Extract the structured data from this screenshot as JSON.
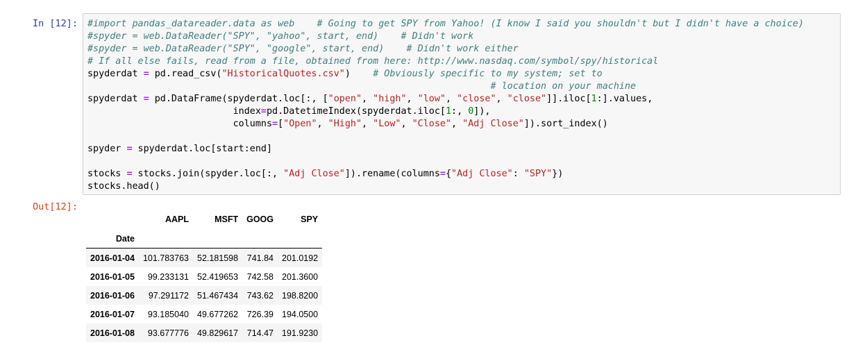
{
  "cell": {
    "in_prompt": "In [12]:",
    "out_prompt": "Out[12]:",
    "code_lines": [
      [
        {
          "t": "c",
          "v": "#import pandas_datareader.data as web    # Going to get SPY from Yahoo! (I know I said you shouldn't but I didn't have a choice)"
        }
      ],
      [
        {
          "t": "c",
          "v": "#spyder = web.DataReader(\"SPY\", \"yahoo\", start, end)    # Didn't work"
        }
      ],
      [
        {
          "t": "c",
          "v": "#spyder = web.DataReader(\"SPY\", \"google\", start, end)    # Didn't work either"
        }
      ],
      [
        {
          "t": "c",
          "v": "# If all else fails, read from a file, obtained from here: http://www.nasdaq.com/symbol/spy/historical"
        }
      ],
      [
        {
          "t": "t",
          "v": "spyderdat "
        },
        {
          "t": "o",
          "v": "="
        },
        {
          "t": "t",
          "v": " pd.read_csv("
        },
        {
          "t": "s",
          "v": "\"HistoricalQuotes.csv\""
        },
        {
          "t": "t",
          "v": ")    "
        },
        {
          "t": "c",
          "v": "# Obviously specific to my system; set to"
        }
      ],
      [
        {
          "t": "t",
          "v": "                                                                        "
        },
        {
          "t": "c",
          "v": "# location on your machine"
        }
      ],
      [
        {
          "t": "t",
          "v": "spyderdat "
        },
        {
          "t": "o",
          "v": "="
        },
        {
          "t": "t",
          "v": " pd.DataFrame(spyderdat.loc[:, ["
        },
        {
          "t": "s",
          "v": "\"open\""
        },
        {
          "t": "t",
          "v": ", "
        },
        {
          "t": "s",
          "v": "\"high\""
        },
        {
          "t": "t",
          "v": ", "
        },
        {
          "t": "s",
          "v": "\"low\""
        },
        {
          "t": "t",
          "v": ", "
        },
        {
          "t": "s",
          "v": "\"close\""
        },
        {
          "t": "t",
          "v": ", "
        },
        {
          "t": "s",
          "v": "\"close\""
        },
        {
          "t": "t",
          "v": "]].iloc["
        },
        {
          "t": "n",
          "v": "1"
        },
        {
          "t": "t",
          "v": ":].values,"
        }
      ],
      [
        {
          "t": "t",
          "v": "                          index"
        },
        {
          "t": "o",
          "v": "="
        },
        {
          "t": "t",
          "v": "pd.DatetimeIndex(spyderdat.iloc["
        },
        {
          "t": "n",
          "v": "1"
        },
        {
          "t": "t",
          "v": ":, "
        },
        {
          "t": "n",
          "v": "0"
        },
        {
          "t": "t",
          "v": "]),"
        }
      ],
      [
        {
          "t": "t",
          "v": "                          columns"
        },
        {
          "t": "o",
          "v": "="
        },
        {
          "t": "t",
          "v": "["
        },
        {
          "t": "s",
          "v": "\"Open\""
        },
        {
          "t": "t",
          "v": ", "
        },
        {
          "t": "s",
          "v": "\"High\""
        },
        {
          "t": "t",
          "v": ", "
        },
        {
          "t": "s",
          "v": "\"Low\""
        },
        {
          "t": "t",
          "v": ", "
        },
        {
          "t": "s",
          "v": "\"Close\""
        },
        {
          "t": "t",
          "v": ", "
        },
        {
          "t": "s",
          "v": "\"Adj Close\""
        },
        {
          "t": "t",
          "v": "]).sort_index()"
        }
      ],
      [
        {
          "t": "t",
          "v": ""
        }
      ],
      [
        {
          "t": "t",
          "v": "spyder "
        },
        {
          "t": "o",
          "v": "="
        },
        {
          "t": "t",
          "v": " spyderdat.loc[start:end]"
        }
      ],
      [
        {
          "t": "t",
          "v": ""
        }
      ],
      [
        {
          "t": "t",
          "v": "stocks "
        },
        {
          "t": "o",
          "v": "="
        },
        {
          "t": "t",
          "v": " stocks.join(spyder.loc[:, "
        },
        {
          "t": "s",
          "v": "\"Adj Close\""
        },
        {
          "t": "t",
          "v": "]).rename(columns"
        },
        {
          "t": "o",
          "v": "="
        },
        {
          "t": "t",
          "v": "{"
        },
        {
          "t": "s",
          "v": "\"Adj Close\""
        },
        {
          "t": "t",
          "v": ": "
        },
        {
          "t": "s",
          "v": "\"SPY\""
        },
        {
          "t": "t",
          "v": "})"
        }
      ],
      [
        {
          "t": "t",
          "v": "stocks.head()"
        }
      ]
    ]
  },
  "output": {
    "columns": [
      "AAPL",
      "MSFT",
      "GOOG",
      "SPY"
    ],
    "index_name": "Date",
    "rows": [
      {
        "date": "2016-01-04",
        "values": [
          "101.783763",
          "52.181598",
          "741.84",
          "201.0192"
        ]
      },
      {
        "date": "2016-01-05",
        "values": [
          "99.233131",
          "52.419653",
          "742.58",
          "201.3600"
        ]
      },
      {
        "date": "2016-01-06",
        "values": [
          "97.291172",
          "51.467434",
          "743.62",
          "198.8200"
        ]
      },
      {
        "date": "2016-01-07",
        "values": [
          "93.185040",
          "49.677262",
          "726.39",
          "194.0500"
        ]
      },
      {
        "date": "2016-01-08",
        "values": [
          "93.677776",
          "49.829617",
          "714.47",
          "191.9230"
        ]
      }
    ]
  },
  "colors": {
    "in_prompt": "#303f9f",
    "out_prompt": "#d84315",
    "comment": "#408080",
    "string": "#ba2121",
    "operator": "#aa22ff",
    "number": "#008000",
    "input_bg": "#f7f7f7",
    "input_border": "#cfcfcf"
  }
}
